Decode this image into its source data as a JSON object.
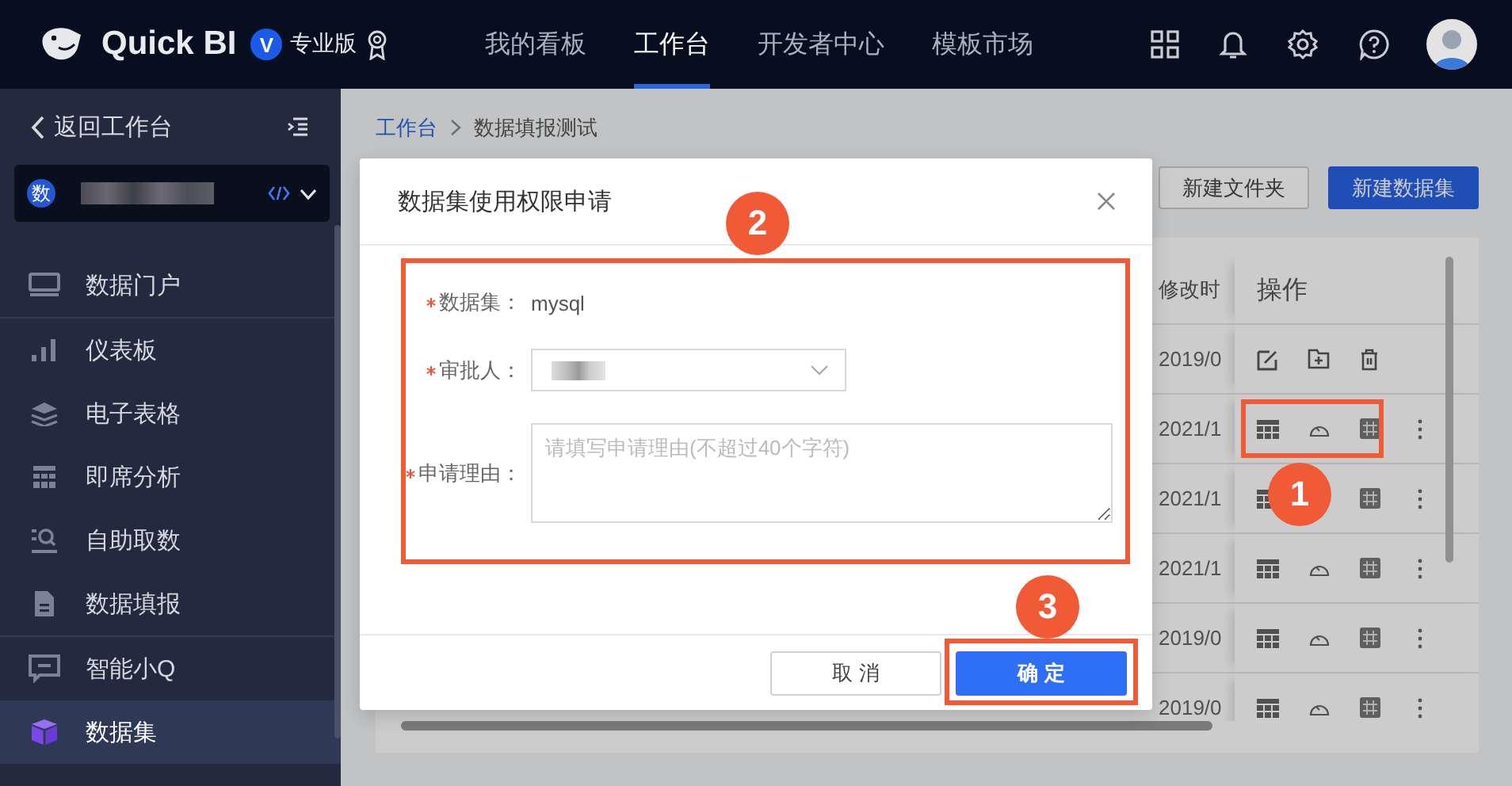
{
  "header": {
    "product": "Quick BI",
    "edition_badge": "V",
    "edition": "专业版",
    "nav": [
      {
        "label": "我的看板",
        "selected": false
      },
      {
        "label": "工作台",
        "selected": true
      },
      {
        "label": "开发者中心",
        "selected": false
      },
      {
        "label": "模板市场",
        "selected": false
      }
    ]
  },
  "sidebar": {
    "back": "返回工作台",
    "workspace": {
      "badge": "数"
    },
    "groups": [
      [
        {
          "label": "数据门户",
          "selected": false
        }
      ],
      [
        {
          "label": "仪表板",
          "selected": false
        },
        {
          "label": "电子表格",
          "selected": false
        },
        {
          "label": "即席分析",
          "selected": false
        },
        {
          "label": "自助取数",
          "selected": false
        },
        {
          "label": "数据填报",
          "selected": false
        }
      ],
      [
        {
          "label": "智能小Q",
          "selected": false
        },
        {
          "label": "数据集",
          "selected": true
        }
      ]
    ]
  },
  "breadcrumb": [
    {
      "label": "工作台"
    },
    {
      "label": "数据填报测试"
    }
  ],
  "toolbar": {
    "buttons": [
      {
        "label": "新建文件夹",
        "kind": "default"
      },
      {
        "label": "新建数据集",
        "kind": "primary"
      }
    ]
  },
  "table": {
    "columns": [
      "修改时",
      "操作"
    ],
    "rows": [
      {
        "modified": "2019/0",
        "kind": "folder"
      },
      {
        "modified": "2021/1",
        "kind": "dataset"
      },
      {
        "modified": "2021/1",
        "kind": "dataset"
      },
      {
        "modified": "2021/1",
        "kind": "dataset"
      },
      {
        "modified": "2019/0",
        "kind": "dataset"
      },
      {
        "modified": "2019/0",
        "kind": "dataset"
      }
    ]
  },
  "dialog": {
    "title": "数据集使用权限申请",
    "fields": [
      {
        "label": "数据集：",
        "required": true,
        "kind": "text",
        "value": "mysql"
      },
      {
        "label": "审批人：",
        "required": true,
        "kind": "select"
      },
      {
        "label": "申请理由：",
        "required": true,
        "kind": "textarea",
        "placeholder": "请填写申请理由(不超过40个字符)"
      }
    ],
    "buttons": [
      {
        "label": "取 消",
        "kind": "default"
      },
      {
        "label": "确 定",
        "kind": "primary"
      }
    ]
  },
  "annotations": [
    {
      "number": "1"
    },
    {
      "number": "2"
    },
    {
      "number": "3"
    }
  ]
}
